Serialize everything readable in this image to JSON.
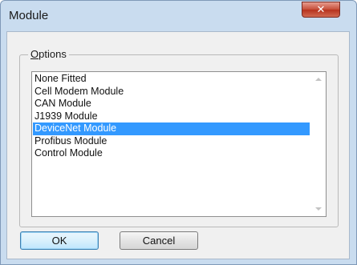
{
  "window": {
    "title": "Module",
    "close_symbol": "✕",
    "accent_color": "#3399ff"
  },
  "options": {
    "group_label": "Options",
    "items": [
      {
        "label": "None Fitted",
        "selected": false
      },
      {
        "label": "Cell Modem Module",
        "selected": false
      },
      {
        "label": "CAN Module",
        "selected": false
      },
      {
        "label": "J1939 Module",
        "selected": false
      },
      {
        "label": "DeviceNet Module",
        "selected": true
      },
      {
        "label": "Profibus Module",
        "selected": false
      },
      {
        "label": "Control Module",
        "selected": false
      }
    ]
  },
  "buttons": {
    "ok_label": "OK",
    "cancel_label": "Cancel"
  }
}
